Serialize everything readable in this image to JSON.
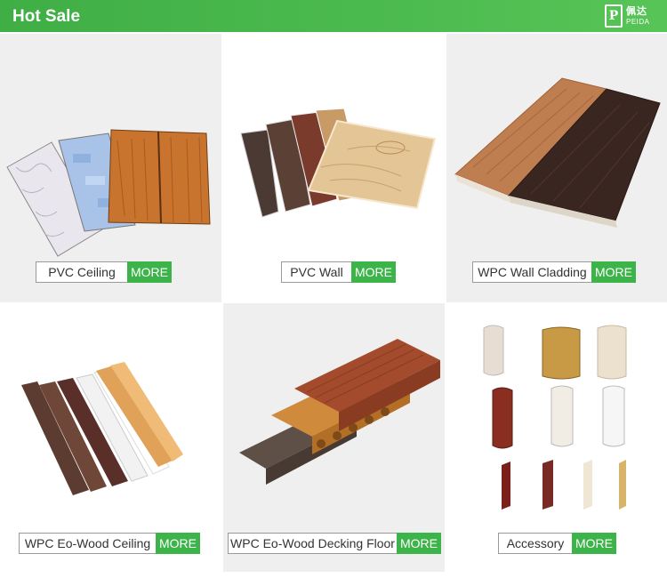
{
  "header": {
    "title": "Hot Sale"
  },
  "logo": {
    "mark": "P",
    "cn": "佩达",
    "en": "PEIDA"
  },
  "colors": {
    "brand_green": "#3db44a",
    "header_green": "#4cbb4f"
  },
  "products": [
    {
      "name": "PVC Ceiling",
      "more": "MORE",
      "image_icon": "pvc-ceiling-panels-icon"
    },
    {
      "name": "PVC Wall",
      "more": "MORE",
      "image_icon": "pvc-wall-panels-icon"
    },
    {
      "name": "WPC Wall Cladding",
      "more": "MORE",
      "image_icon": "wpc-wall-cladding-icon"
    },
    {
      "name": "WPC Eo-Wood  Ceiling",
      "more": "MORE",
      "image_icon": "wpc-ceiling-beams-icon"
    },
    {
      "name": "WPC Eo-Wood Decking Floor",
      "more": "MORE",
      "image_icon": "wpc-decking-boards-icon"
    },
    {
      "name": "Accessory",
      "more": "MORE",
      "image_icon": "trim-profiles-icon"
    }
  ]
}
